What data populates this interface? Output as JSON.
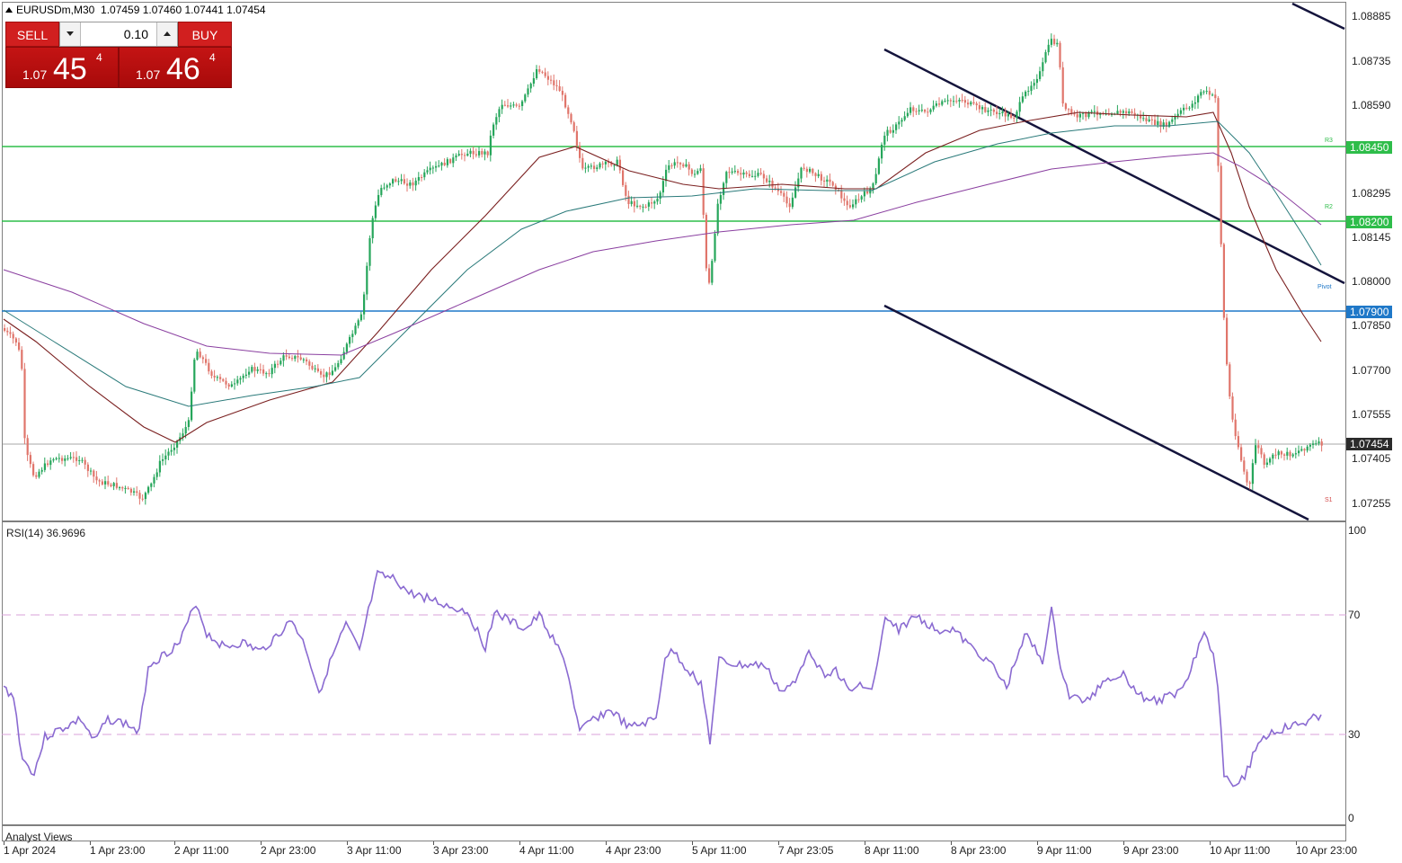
{
  "header": {
    "symbol": "EURUSDm,M30",
    "ohlc": "1.07459 1.07460 1.07441 1.07454"
  },
  "trade_panel": {
    "sell_label": "SELL",
    "buy_label": "BUY",
    "lot_value": "0.10",
    "sell_price_small": "1.07",
    "sell_price_main": "45",
    "sell_price_sup": "4",
    "buy_price_small": "1.07",
    "buy_price_main": "46",
    "buy_price_sup": "4"
  },
  "price_axis": {
    "labels": [
      "1.08885",
      "1.08735",
      "1.08590",
      "1.08295",
      "1.08145",
      "1.08000",
      "1.07850",
      "1.07700",
      "1.07555",
      "1.07405",
      "1.07255"
    ],
    "tags": [
      {
        "text": "1.08450",
        "color": "#2ebd4a"
      },
      {
        "text": "1.08200",
        "color": "#2ebd4a"
      },
      {
        "text": "1.07900",
        "color": "#1f78c8"
      },
      {
        "text": "1.07454",
        "color": "#2b2b2b"
      }
    ],
    "pivot_labels": [
      "R3",
      "R2",
      "Pivot",
      "S1"
    ]
  },
  "rsi": {
    "label": "RSI(14) 36.9696",
    "axis_labels": [
      "100",
      "70",
      "30",
      "0"
    ]
  },
  "analyst_views": "Analyst Views",
  "time_axis": {
    "labels": [
      "1 Apr 2024",
      "1 Apr 23:00",
      "2 Apr 11:00",
      "2 Apr 23:00",
      "3 Apr 11:00",
      "3 Apr 23:00",
      "4 Apr 11:00",
      "4 Apr 23:00",
      "5 Apr 11:00",
      "7 Apr 23:05",
      "8 Apr 11:00",
      "8 Apr 23:00",
      "9 Apr 11:00",
      "9 Apr 23:00",
      "10 Apr 11:00",
      "10 Apr 23:00"
    ]
  },
  "colors": {
    "bull": "#26a65b",
    "bear": "#e0756b",
    "support_line": "#2ebd4a",
    "pivot_line": "#1f78c8",
    "channel": "#14143c",
    "rsi_line": "#8a6ad1"
  }
}
